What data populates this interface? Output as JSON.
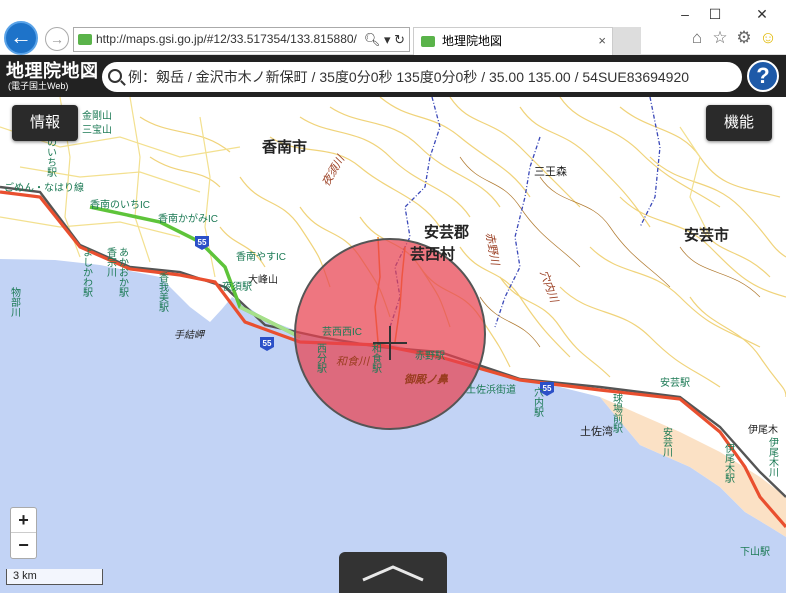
{
  "browser": {
    "window_controls": {
      "minimize": "–",
      "maximize": "☐",
      "close": "✕"
    },
    "address_url": "http://maps.gsi.go.jp/#12/33.517354/133.815880/",
    "tab_title": "地理院地図",
    "tab_close": "×",
    "toolbar_icons": [
      "home-icon",
      "star-icon",
      "gear-icon",
      "smiley-icon"
    ]
  },
  "app": {
    "logo_title": "地理院地図",
    "logo_subtitle": "(電子国土Web)",
    "search_placeholder": "例：剱岳 / 金沢市木ノ新保町 / 35度0分0秒 135度0分0秒 / 35.00 135.00 / 54SUE83694920",
    "help_label": "?"
  },
  "map": {
    "info_button": "情報",
    "function_button": "機能",
    "zoom_in": "+",
    "zoom_out": "−",
    "scale_label": "3 km",
    "route_number": "55",
    "colors": {
      "sea": "#c2d3f5",
      "land": "#ffffff",
      "highway": "#5ec43a",
      "national_road": "#e94f2f",
      "contour": "#f0d37a",
      "circle_fill": "#e8414f",
      "circle_stroke": "#555555"
    },
    "labels": {
      "konan_city": "香南市",
      "aki_district": "安芸郡",
      "geisei_village": "芸西村",
      "aki_city": "安芸市",
      "yasu_river": "夜須川",
      "akano_river": "赤野川",
      "anai_river": "穴内川",
      "sanno_mori": "三王森",
      "konan_noichi_ic": "香南のいちIC",
      "konan_kagami_ic": "香南かがみIC",
      "konan_yasu_ic": "香南やすIC",
      "geisei_nishi_ic": "芸西西IC",
      "ogohoyama": "大峰山",
      "yasu_station": "夜須駅",
      "tezui_misaki": "手結岬",
      "nishibun_station": "西分駅",
      "wajiki_river": "和食川",
      "wajiki_station": "和食駅",
      "akano_station": "赤野駅",
      "gotono_hana": "御殿ノ鼻",
      "tosa_hama_kaido": "土佐浜街道",
      "anai_station": "穴内駅",
      "tosa_bay": "土佐湾",
      "kyujo_mae_station": "球場前駅",
      "aki_station": "安芸駅",
      "aki_river": "安芸川",
      "iono_station": "伊尾木駅",
      "iono_river": "伊尾木川",
      "iono_label": "伊尾木",
      "shimoyama_station": "下山駅",
      "akaoka_station": "あかおか駅",
      "noichi_station": "のいち駅",
      "yoshikawa_station": "よしかわ駅",
      "konomi_station": "香我美駅",
      "kosomune_river": "香宗川",
      "mononobe_river": "物部川",
      "kanedayama": "金剛山",
      "sanpoyama": "三宝山",
      "noichi_hora": "のいち",
      "gomen_line": "ごめん・なはり線"
    }
  }
}
